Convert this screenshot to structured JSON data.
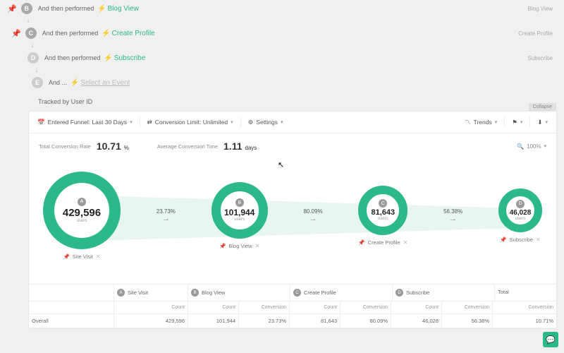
{
  "steps": [
    {
      "letter": "B",
      "text": "And then performed",
      "event": "Blog View",
      "right": "Blog View",
      "pin": true
    },
    {
      "letter": "C",
      "text": "And then performed",
      "event": "Create Profile",
      "right": "Create Profile",
      "pin": true
    },
    {
      "letter": "D",
      "text": "And then performed",
      "event": "Subscribe",
      "right": "Subscribe",
      "pin": false
    },
    {
      "letter": "E",
      "text": "And ...",
      "placeholder": "Select an Event",
      "pin": false
    }
  ],
  "tracked": "Tracked by User ID",
  "collapse": "Collapse",
  "toolbar": {
    "date": "Entered Funnel: Last 30 Days",
    "limit": "Conversion Limit: Unlimited",
    "settings": "Settings",
    "trends": "Trends"
  },
  "metrics": {
    "rate_label": "Total\nConversion\nRate",
    "rate": "10.71",
    "rate_unit": "%",
    "time_label": "Average\nConversion\nTime",
    "time": "1.11",
    "time_unit": "days"
  },
  "zoom": "100%",
  "chart_data": {
    "type": "funnel",
    "stages": [
      {
        "letter": "A",
        "label": "Site Visit",
        "users": 429596,
        "display": "429,596"
      },
      {
        "letter": "B",
        "label": "Blog View",
        "users": 101944,
        "display": "101,944",
        "conversion": 23.73
      },
      {
        "letter": "C",
        "label": "Create Profile",
        "users": 81643,
        "display": "81,643",
        "conversion": 80.09
      },
      {
        "letter": "D",
        "label": "Subscribe",
        "users": 46028,
        "display": "46,028",
        "conversion": 56.38
      }
    ],
    "users_label": "users"
  },
  "table": {
    "headers": [
      "",
      "Site Visit",
      "Blog View",
      "Create Profile",
      "Subscribe",
      "Total"
    ],
    "letters": [
      "A",
      "B",
      "C",
      "D"
    ],
    "sub": [
      "",
      "Count",
      "Count",
      "Conversion",
      "Count",
      "Conversion",
      "Count",
      "Conversion",
      "Conversion"
    ],
    "rows": [
      {
        "label": "Overall",
        "cells": [
          "429,596",
          "101,944",
          "23.73%",
          "81,643",
          "80.09%",
          "46,028",
          "56.38%",
          "10.71%"
        ]
      }
    ]
  }
}
